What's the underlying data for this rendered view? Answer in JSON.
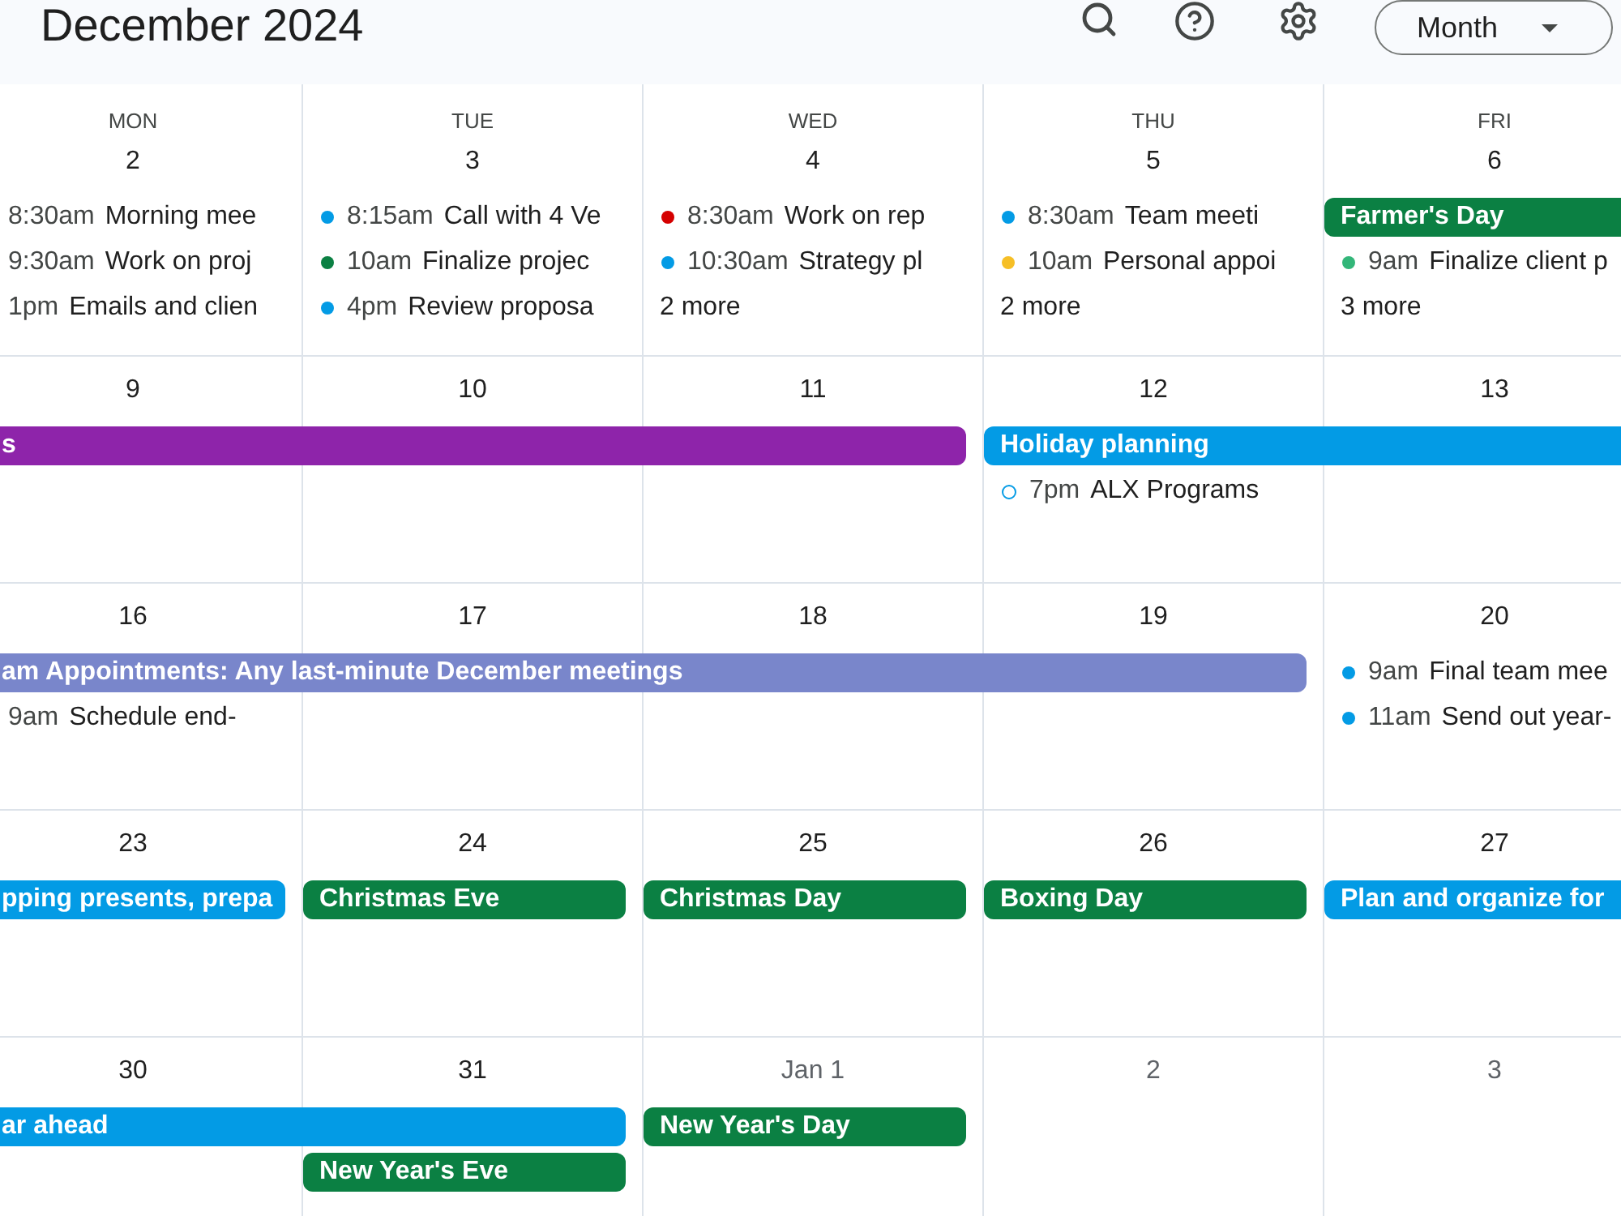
{
  "header": {
    "title": "December 2024",
    "view_button": "Month"
  },
  "weekdays": [
    "MON",
    "TUE",
    "WED",
    "THU",
    "FRI"
  ],
  "weeks": [
    {
      "days": [
        {
          "date": "2",
          "other_month": false
        },
        {
          "date": "3",
          "other_month": false
        },
        {
          "date": "4",
          "other_month": false
        },
        {
          "date": "5",
          "other_month": false
        },
        {
          "date": "6",
          "other_month": false
        }
      ],
      "lanes": [
        [
          {
            "kind": "timed",
            "time": "8:30am",
            "title": "Morning mee"
          },
          {
            "kind": "timed",
            "time": "8:15am",
            "title": "Call with 4 Ve",
            "color": "#039be5"
          },
          {
            "kind": "timed",
            "time": "8:30am",
            "title": "Work on rep",
            "color": "#d50000"
          },
          {
            "kind": "timed",
            "time": "8:30am",
            "title": "Team meeti",
            "color": "#039be5"
          },
          {
            "kind": "bar",
            "title": "Farmer's Day",
            "color": "#0b8043"
          }
        ],
        [
          {
            "kind": "timed",
            "time": "9:30am",
            "title": "Work on proj"
          },
          {
            "kind": "timed",
            "time": "10am",
            "title": "Finalize projec",
            "color": "#0b8043"
          },
          {
            "kind": "timed",
            "time": "10:30am",
            "title": "Strategy pl",
            "color": "#039be5"
          },
          {
            "kind": "timed",
            "time": "10am",
            "title": "Personal appoi",
            "color": "#f6bf26"
          },
          {
            "kind": "timed",
            "time": "9am",
            "title": "Finalize client p",
            "color": "#33b679"
          }
        ],
        [
          {
            "kind": "timed",
            "time": "1pm",
            "title": "Emails and clien"
          },
          {
            "kind": "timed",
            "time": "4pm",
            "title": "Review proposa",
            "color": "#039be5"
          },
          {
            "kind": "more",
            "label": "2 more"
          },
          {
            "kind": "more",
            "label": "2 more"
          },
          {
            "kind": "more",
            "label": "3 more"
          }
        ]
      ]
    },
    {
      "days": [
        {
          "date": "9",
          "other_month": false
        },
        {
          "date": "10",
          "other_month": false
        },
        {
          "date": "11",
          "other_month": false
        },
        {
          "date": "12",
          "other_month": false
        },
        {
          "date": "13",
          "other_month": false
        }
      ],
      "lanes": [
        [
          {
            "kind": "bar",
            "title": "s",
            "color": "#8e24aa"
          },
          {
            "kind": "continued"
          },
          {
            "kind": "continued"
          },
          {
            "kind": "bar",
            "title": "Holiday planning",
            "color": "#039be5"
          },
          {
            "kind": "continued"
          }
        ],
        [
          {
            "kind": "empty"
          },
          {
            "kind": "empty"
          },
          {
            "kind": "empty"
          },
          {
            "kind": "hollow",
            "time": "7pm",
            "title": "ALX Programs",
            "color": "#039be5"
          },
          {
            "kind": "empty"
          }
        ]
      ]
    },
    {
      "days": [
        {
          "date": "16",
          "other_month": false
        },
        {
          "date": "17",
          "other_month": false
        },
        {
          "date": "18",
          "other_month": false
        },
        {
          "date": "19",
          "other_month": false
        },
        {
          "date": "20",
          "other_month": false
        }
      ],
      "lanes": [
        [
          {
            "kind": "bar",
            "title": "am Appointments: Any last-minute December meetings",
            "color": "#7986cb"
          },
          {
            "kind": "continued"
          },
          {
            "kind": "continued"
          },
          {
            "kind": "continued"
          },
          {
            "kind": "timed",
            "time": "9am",
            "title": "Final team mee",
            "color": "#039be5"
          }
        ],
        [
          {
            "kind": "timed",
            "time": "9am",
            "title": "Schedule end-"
          },
          {
            "kind": "empty"
          },
          {
            "kind": "empty"
          },
          {
            "kind": "empty"
          },
          {
            "kind": "timed",
            "time": "11am",
            "title": "Send out year-",
            "color": "#039be5"
          }
        ]
      ]
    },
    {
      "days": [
        {
          "date": "23",
          "other_month": false
        },
        {
          "date": "24",
          "other_month": false
        },
        {
          "date": "25",
          "other_month": false
        },
        {
          "date": "26",
          "other_month": false
        },
        {
          "date": "27",
          "other_month": false
        }
      ],
      "lanes": [
        [
          {
            "kind": "bar",
            "title": "pping presents, prepa",
            "color": "#039be5"
          },
          {
            "kind": "bar",
            "title": "Christmas Eve",
            "color": "#0b8043"
          },
          {
            "kind": "bar",
            "title": "Christmas Day",
            "color": "#0b8043"
          },
          {
            "kind": "bar",
            "title": "Boxing Day",
            "color": "#0b8043"
          },
          {
            "kind": "bar",
            "title": "Plan and organize for",
            "color": "#039be5"
          }
        ]
      ]
    },
    {
      "days": [
        {
          "date": "30",
          "other_month": false
        },
        {
          "date": "31",
          "other_month": false
        },
        {
          "date": "Jan 1",
          "other_month": true
        },
        {
          "date": "2",
          "other_month": true
        },
        {
          "date": "3",
          "other_month": true
        }
      ],
      "lanes": [
        [
          {
            "kind": "bar",
            "title": "ar ahead",
            "color": "#039be5"
          },
          {
            "kind": "continued"
          },
          {
            "kind": "bar",
            "title": "New Year's Day",
            "color": "#0b8043"
          },
          {
            "kind": "empty"
          },
          {
            "kind": "empty"
          }
        ],
        [
          {
            "kind": "empty"
          },
          {
            "kind": "bar",
            "title": "New Year's Eve",
            "color": "#0b8043"
          },
          {
            "kind": "empty"
          },
          {
            "kind": "empty"
          },
          {
            "kind": "empty"
          }
        ]
      ]
    }
  ]
}
